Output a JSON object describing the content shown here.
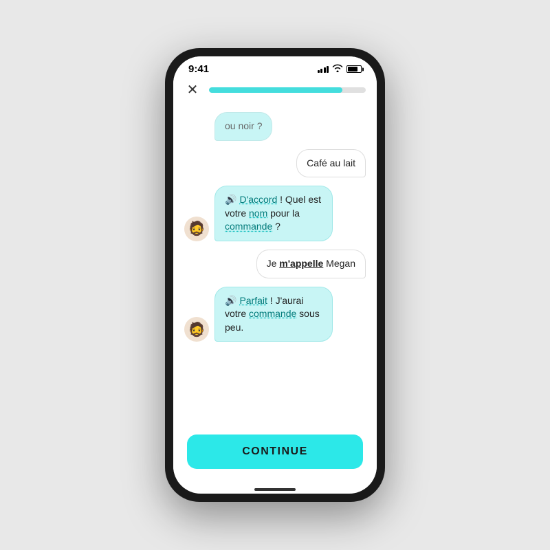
{
  "status": {
    "time": "9:41",
    "progress_percent": 85
  },
  "nav": {
    "close_label": "✕"
  },
  "messages": [
    {
      "id": "msg1",
      "side": "left",
      "text": "ou noir ?",
      "has_avatar": false,
      "partial": true
    },
    {
      "id": "msg2",
      "side": "right",
      "text": "Café au lait",
      "has_avatar": false
    },
    {
      "id": "msg3",
      "side": "left",
      "has_avatar": true,
      "has_speaker": true,
      "text_parts": [
        {
          "type": "speaker"
        },
        {
          "type": "dashed",
          "text": "D'accord"
        },
        {
          "type": "normal",
          "text": " ! Quel est votre "
        },
        {
          "type": "dashed",
          "text": "nom"
        },
        {
          "type": "normal",
          "text": " pour la "
        },
        {
          "type": "dashed",
          "text": "commande"
        },
        {
          "type": "normal",
          "text": " ?"
        }
      ]
    },
    {
      "id": "msg4",
      "side": "right",
      "text_parts": [
        {
          "type": "normal",
          "text": "Je "
        },
        {
          "type": "bold-underline",
          "text": "m'appelle"
        },
        {
          "type": "normal",
          "text": " Megan"
        }
      ]
    },
    {
      "id": "msg5",
      "side": "left",
      "has_avatar": true,
      "has_speaker": true,
      "text_parts": [
        {
          "type": "speaker"
        },
        {
          "type": "dashed",
          "text": "Parfait"
        },
        {
          "type": "normal",
          "text": " ! J'aurai votre "
        },
        {
          "type": "dashed",
          "text": "commande"
        },
        {
          "type": "normal",
          "text": " sous peu."
        }
      ]
    }
  ],
  "continue_button": {
    "label": "CONTINUE"
  },
  "avatar_emoji": "🧔",
  "speaker_emoji": "🔊"
}
